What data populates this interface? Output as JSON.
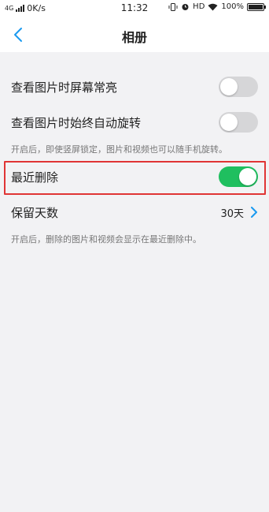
{
  "status_bar": {
    "network": "4G",
    "speed": "0K/s",
    "time": "11:32",
    "hd": "HD",
    "battery": "100%",
    "battery_level": 1.0
  },
  "nav": {
    "title": "相册",
    "back_icon": "chevron-left-icon"
  },
  "settings": [
    {
      "label": "查看图片时屏幕常亮",
      "enabled": false
    },
    {
      "label": "查看图片时始终自动旋转",
      "enabled": false
    }
  ],
  "rotate_hint": "开启后，即使竖屏锁定，图片和视频也可以随手机旋转。",
  "recently_deleted": {
    "label": "最近删除",
    "enabled": true
  },
  "retention": {
    "label": "保留天数",
    "value": "30天"
  },
  "retention_hint": "开启后，删除的图片和视频会显示在最近删除中。",
  "colors": {
    "accent": "#1fbf5f",
    "link_blue": "#1a9af0",
    "highlight": "#e03535"
  }
}
